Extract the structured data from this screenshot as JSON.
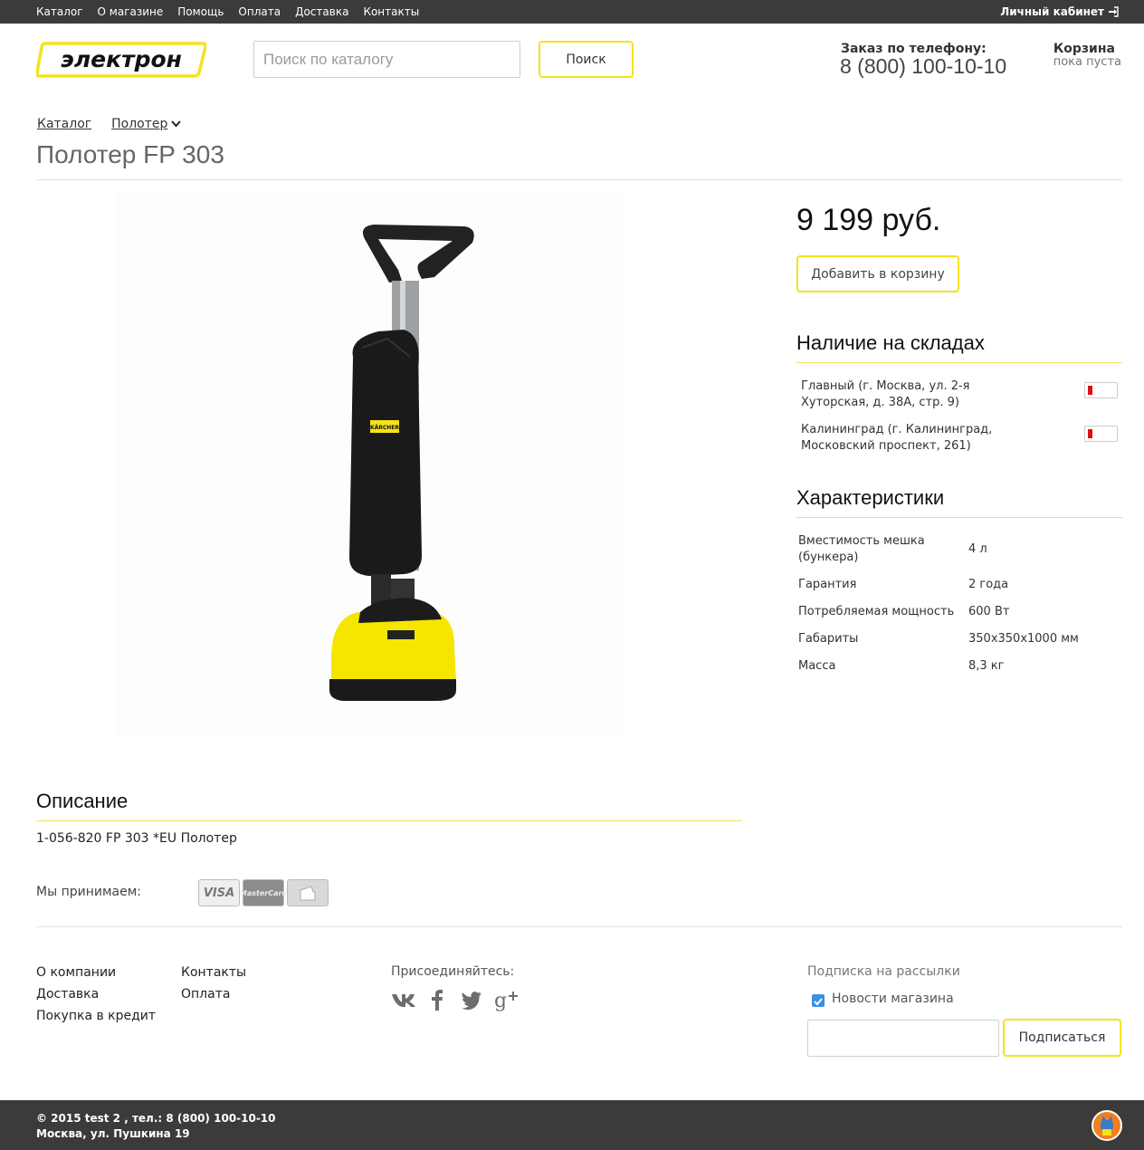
{
  "topbar": {
    "nav": [
      "Каталог",
      "О магазине",
      "Помощь",
      "Оплата",
      "Доставка",
      "Контакты"
    ],
    "cabinet": "Личный кабинет"
  },
  "header": {
    "logo_text": "электрон",
    "search_placeholder": "Поиск по каталогу",
    "search_button": "Поиск",
    "phone_label": "Заказ по телефону:",
    "phone_number": "8 (800) 100-10-10",
    "cart_title": "Корзина",
    "cart_status": "пока пуста"
  },
  "breadcrumb": [
    "Каталог",
    "Полотер"
  ],
  "product": {
    "title": "Полотер FP 303",
    "price": "9 199 руб.",
    "add_to_cart": "Добавить в корзину",
    "image_brand": "KÄRCHER"
  },
  "stock": {
    "heading": "Наличие на складах",
    "items": [
      {
        "address": "Главный (г. Москва, ул. 2-я Хуторская, д. 38А, стр. 9)",
        "level": 0.15
      },
      {
        "address": "Калининград (г. Калининград, Московский проспект, 261)",
        "level": 0.15
      }
    ]
  },
  "specs": {
    "heading": "Характеристики",
    "rows": [
      {
        "k": "Вместимость мешка (бункера)",
        "v": "4 л"
      },
      {
        "k": "Гарантия",
        "v": "2 года"
      },
      {
        "k": "Потребляемая мощность",
        "v": "600 Вт"
      },
      {
        "k": "Габариты",
        "v": "350x350x1000 мм"
      },
      {
        "k": "Масса",
        "v": "8,3 кг"
      }
    ]
  },
  "description": {
    "heading": "Описание",
    "text": "1-056-820 FP 303  *EU Полотер",
    "pay_label": "Мы принимаем:",
    "cards": [
      "VISA",
      "MasterCard"
    ]
  },
  "footer": {
    "col1": [
      "О компании",
      "Доставка",
      "Покупка в кредит"
    ],
    "col2": [
      "Контакты",
      "Оплата"
    ],
    "join": "Присоединяйтесь:",
    "subscribe_label": "Подписка на рассылки",
    "subscribe_option": "Новости магазина",
    "subscribe_button": "Подписаться",
    "copyright": "© 2015 test 2 , тел.: 8 (800) 100-10-10",
    "address": "Москва, ул. Пушкина 19"
  },
  "colors": {
    "accent": "#f5e21c",
    "dark_bar": "#3b3b3b",
    "stock_low": "#e01010"
  }
}
